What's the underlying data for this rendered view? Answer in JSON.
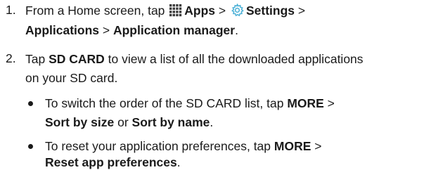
{
  "steps": [
    {
      "number": "1.",
      "line1": {
        "t1": "From a Home screen, tap ",
        "apps_icon": "apps-grid-icon",
        "b1": "Apps",
        "t2": " > ",
        "settings_icon": "settings-gear-icon",
        "b2": "Settings",
        "t3": " >"
      },
      "line2": {
        "b1": "Applications",
        "t1": " > ",
        "b2": "Application manager",
        "t2": "."
      }
    },
    {
      "number": "2.",
      "line1": {
        "t1": "Tap ",
        "b1": "SD CARD",
        "t2": " to view a list of all the downloaded applications"
      },
      "line2": {
        "t1": "on your SD card."
      },
      "bullets": [
        {
          "line1": {
            "t1": "To switch the order of the SD CARD list, tap ",
            "b1": "MORE",
            "t2": " >"
          },
          "line2": {
            "b1": "Sort by size",
            "t1": " or ",
            "b2": "Sort by name",
            "t2": "."
          }
        },
        {
          "line1": {
            "t1": "To reset your application preferences, tap ",
            "b1": "MORE",
            "t2": " >"
          },
          "line2": {
            "b1": "Reset app preferences",
            "t1": "."
          }
        }
      ]
    }
  ],
  "colors": {
    "text": "#1a1a1a",
    "apps_icon": "#3a3a3a",
    "settings_icon": "#4ab0d6"
  }
}
